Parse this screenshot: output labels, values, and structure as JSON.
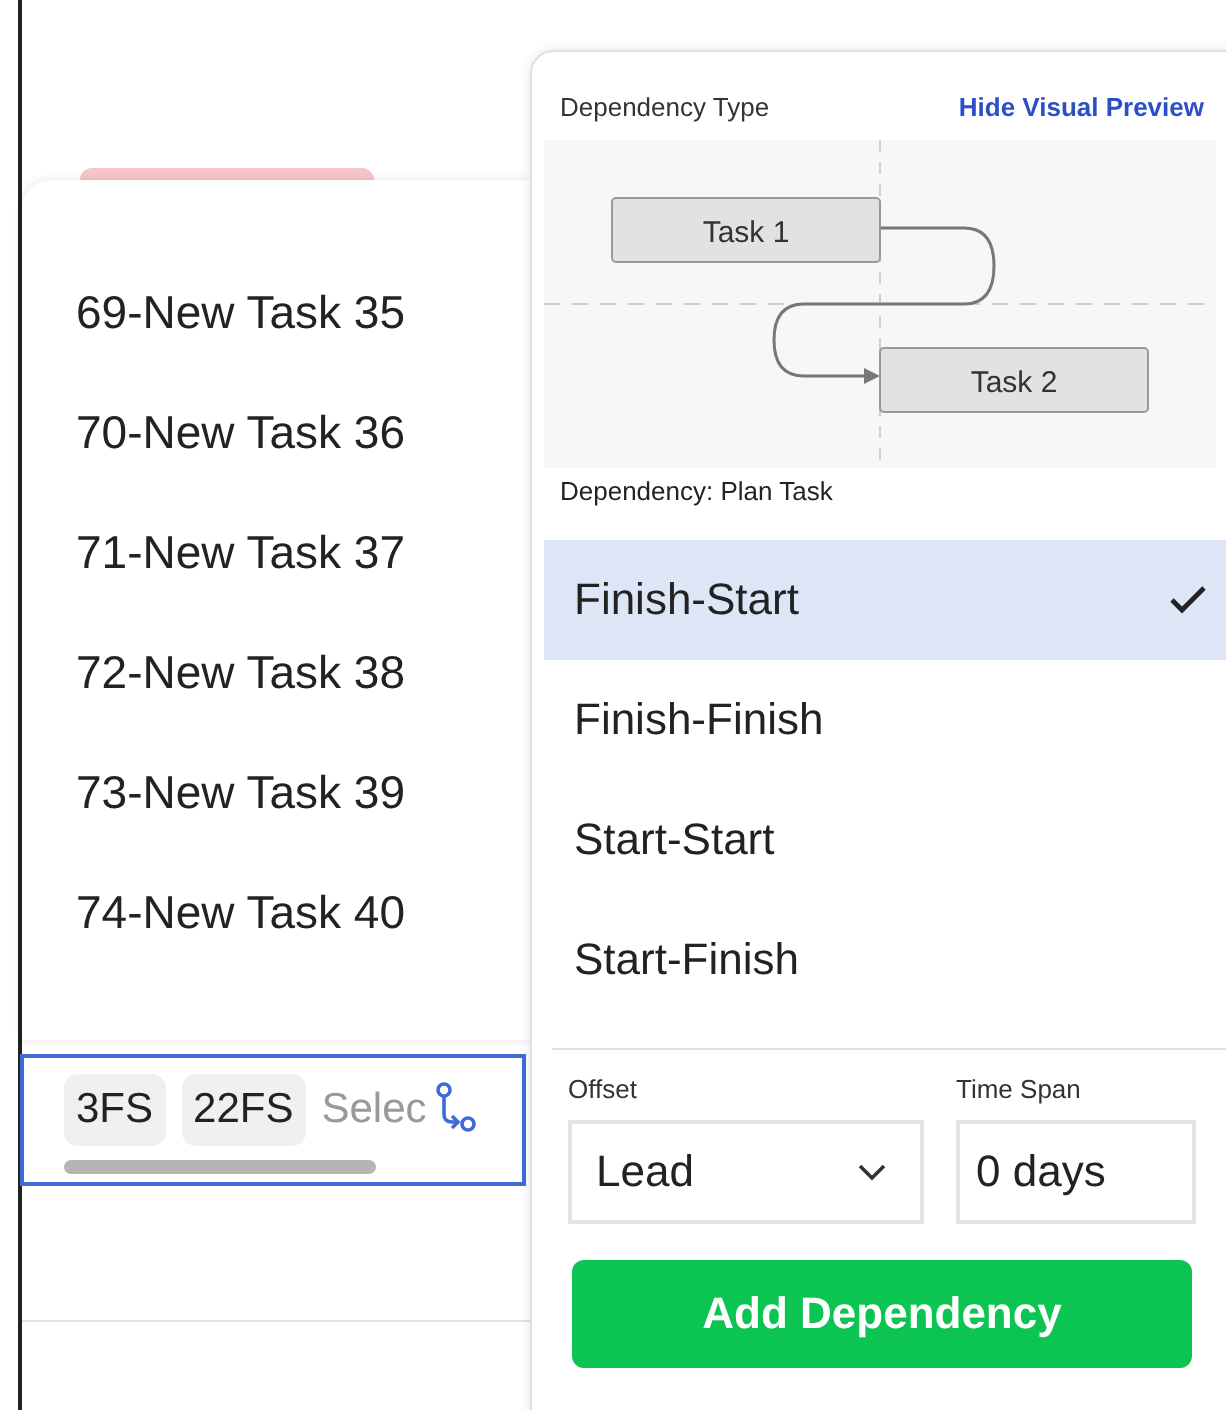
{
  "task_list": {
    "items": [
      {
        "label": "69-New Task 35"
      },
      {
        "label": "70-New Task 36"
      },
      {
        "label": "71-New Task 37"
      },
      {
        "label": "72-New Task 38"
      },
      {
        "label": "73-New Task 39"
      },
      {
        "label": "74-New Task 40"
      }
    ]
  },
  "dependency_field": {
    "chips": [
      "3FS",
      "22FS"
    ],
    "placeholder": "Selec"
  },
  "panel": {
    "title": "Dependency Type",
    "toggle_link": "Hide Visual Preview",
    "preview": {
      "task_a": "Task 1",
      "task_b": "Task 2"
    },
    "caption": "Dependency: Plan Task",
    "types": [
      {
        "label": "Finish-Start",
        "selected": true
      },
      {
        "label": "Finish-Finish",
        "selected": false
      },
      {
        "label": "Start-Start",
        "selected": false
      },
      {
        "label": "Start-Finish",
        "selected": false
      }
    ],
    "offset": {
      "label": "Offset",
      "value": "Lead"
    },
    "time_span": {
      "label": "Time Span",
      "value": "0 days"
    },
    "button": "Add Dependency"
  }
}
